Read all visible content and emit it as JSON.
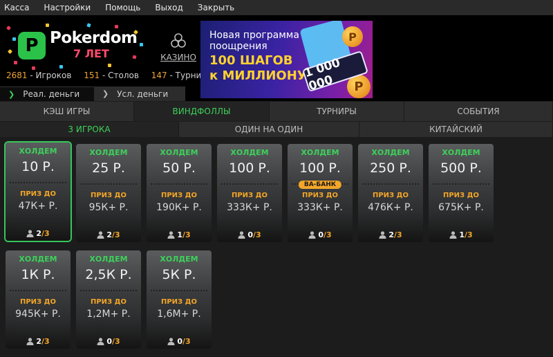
{
  "menu": [
    "Касса",
    "Настройки",
    "Помощь",
    "Выход",
    "Закрыть"
  ],
  "logo": {
    "brand": "Pokerdom",
    "subtitle": "7 ЛЕТ"
  },
  "casino_label": "КАЗИНО",
  "stats": [
    {
      "value": "2681",
      "label": "- Игроков"
    },
    {
      "value": "151",
      "label": "- Столов"
    },
    {
      "value": "147",
      "label": "- Турниров"
    }
  ],
  "money_tabs": [
    "Реал. деньги",
    "Усл. деньги"
  ],
  "banner": {
    "line1": "Новая программа",
    "line2": "поощрения",
    "line3": "100 ШАГОВ",
    "line4": "к МИЛЛИОНУ",
    "plate": "1 000 000"
  },
  "game_tabs": [
    "КЭШ ИГРЫ",
    "ВИНДФОЛЛЫ",
    "ТУРНИРЫ",
    "СОБЫТИЯ"
  ],
  "sub_tabs": [
    "3 ИГРОКА",
    "ОДИН НА ОДИН",
    "КИТАЙСКИЙ"
  ],
  "tables": [
    {
      "game": "ХОЛДЕМ",
      "stake": "10 Р.",
      "prize_label": "ПРИЗ ДО",
      "prize": "47К+ Р.",
      "players": "2",
      "max": "/3",
      "badge": ""
    },
    {
      "game": "ХОЛДЕМ",
      "stake": "25 Р.",
      "prize_label": "ПРИЗ ДО",
      "prize": "95К+ Р.",
      "players": "2",
      "max": "/3",
      "badge": ""
    },
    {
      "game": "ХОЛДЕМ",
      "stake": "50 Р.",
      "prize_label": "ПРИЗ ДО",
      "prize": "190К+ Р.",
      "players": "1",
      "max": "/3",
      "badge": ""
    },
    {
      "game": "ХОЛДЕМ",
      "stake": "100 Р.",
      "prize_label": "ПРИЗ ДО",
      "prize": "333К+ Р.",
      "players": "0",
      "max": "/3",
      "badge": ""
    },
    {
      "game": "ХОЛДЕМ",
      "stake": "100 Р.",
      "prize_label": "ПРИЗ ДО",
      "prize": "333К+ Р.",
      "players": "0",
      "max": "/3",
      "badge": "ВА-БАНК"
    },
    {
      "game": "ХОЛДЕМ",
      "stake": "250 Р.",
      "prize_label": "ПРИЗ ДО",
      "prize": "476К+ Р.",
      "players": "2",
      "max": "/3",
      "badge": ""
    },
    {
      "game": "ХОЛДЕМ",
      "stake": "500 Р.",
      "prize_label": "ПРИЗ ДО",
      "prize": "675К+ Р.",
      "players": "1",
      "max": "/3",
      "badge": ""
    },
    {
      "game": "ХОЛДЕМ",
      "stake": "1К Р.",
      "prize_label": "ПРИЗ ДО",
      "prize": "945К+ Р.",
      "players": "2",
      "max": "/3",
      "badge": ""
    },
    {
      "game": "ХОЛДЕМ",
      "stake": "2,5К Р.",
      "prize_label": "ПРИЗ ДО",
      "prize": "1,2М+ Р.",
      "players": "0",
      "max": "/3",
      "badge": ""
    },
    {
      "game": "ХОЛДЕМ",
      "stake": "5К Р.",
      "prize_label": "ПРИЗ ДО",
      "prize": "1,6М+ Р.",
      "players": "0",
      "max": "/3",
      "badge": ""
    }
  ],
  "colors": {
    "accent": "#3ed15a",
    "prize": "#f3a628",
    "menubar": "#2a2a2a"
  }
}
